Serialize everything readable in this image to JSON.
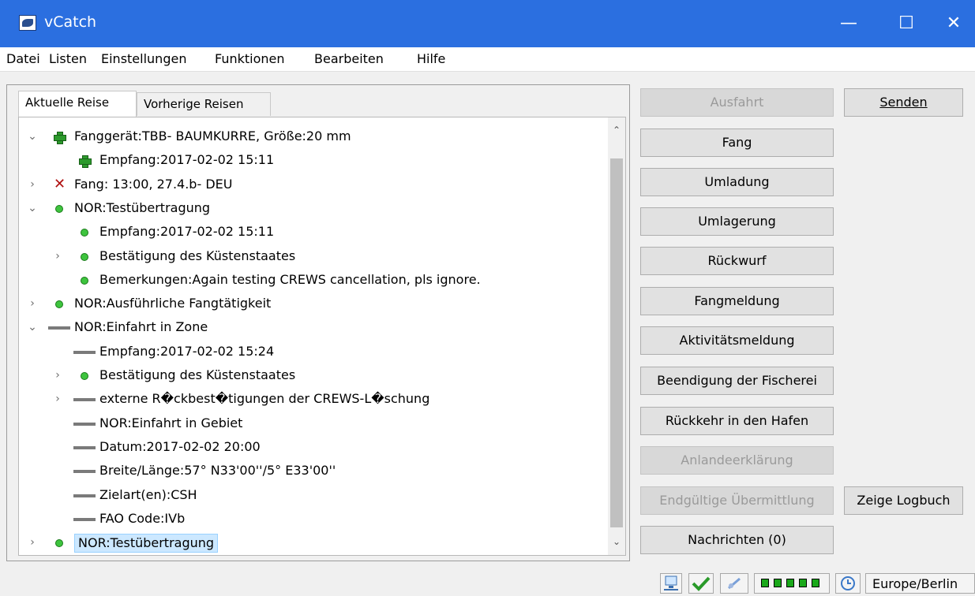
{
  "window": {
    "title": "vCatch",
    "minimize": "—",
    "maximize": "☐",
    "close": "✕"
  },
  "menu": [
    "Datei",
    "Listen",
    "Einstellungen",
    "Funktionen",
    "Bearbeiten",
    "Hilfe"
  ],
  "tabs": {
    "active": "Aktuelle Reise",
    "inactive": "Vorherige Reisen"
  },
  "tree": [
    {
      "label": "Fanggerät:TBB- BAUMKURRE, Größe:20 mm",
      "icon": "plus-icon",
      "expander": "⌄"
    },
    {
      "label": "Empfang:2017-02-02 15:11",
      "icon": "plus-icon",
      "expander": ""
    },
    {
      "label": "Fang: 13:00, 27.4.b- DEU",
      "icon": "cross-icon",
      "expander": "›"
    },
    {
      "label": "NOR:Testübertragung",
      "icon": "green-dot-icon",
      "expander": "⌄"
    },
    {
      "label": "Empfang:2017-02-02 15:11",
      "icon": "green-dot-icon",
      "expander": ""
    },
    {
      "label": "Bestätigung des Küstenstaates",
      "icon": "green-dot-icon",
      "expander": "›"
    },
    {
      "label": "Bemerkungen:Again testing CREWS cancellation, pls ignore.",
      "icon": "green-dot-icon",
      "expander": ""
    },
    {
      "label": "NOR:Ausführliche Fangtätigkeit",
      "icon": "green-dot-icon",
      "expander": "›"
    },
    {
      "label": "NOR:Einfahrt in Zone",
      "icon": "gray-bar-icon",
      "expander": "⌄"
    },
    {
      "label": "Empfang:2017-02-02 15:24",
      "icon": "gray-bar-icon",
      "expander": ""
    },
    {
      "label": "Bestätigung des Küstenstaates",
      "icon": "green-dot-icon",
      "expander": "›"
    },
    {
      "label": "externe R�ckbest�tigungen der CREWS-L�schung",
      "icon": "gray-bar-icon",
      "expander": "›"
    },
    {
      "label": "NOR:Einfahrt in Gebiet",
      "icon": "gray-bar-icon",
      "expander": ""
    },
    {
      "label": "Datum:2017-02-02 20:00",
      "icon": "gray-bar-icon",
      "expander": ""
    },
    {
      "label": "Breite/Länge:57° N33'00''/5° E33'00''",
      "icon": "gray-bar-icon",
      "expander": ""
    },
    {
      "label": "Zielart(en):CSH",
      "icon": "gray-bar-icon",
      "expander": ""
    },
    {
      "label": "FAO Code:IVb",
      "icon": "gray-bar-icon",
      "expander": ""
    },
    {
      "label": "NOR:Testübertragung",
      "icon": "green-dot-icon",
      "expander": "›",
      "selected": true
    }
  ],
  "scroll": {
    "up": "⌃",
    "down": "⌄"
  },
  "buttons": {
    "ausfahrt": "Ausfahrt",
    "fang": "Fang",
    "umladung": "Umladung",
    "umlagerung": "Umlagerung",
    "rueckwurf": "Rückwurf",
    "fangmeldung": "Fangmeldung",
    "aktivitaetsmeldung": "Aktivitätsmeldung",
    "beendigung": "Beendigung der Fischerei",
    "rueckkehr": "Rückkehr in den Hafen",
    "anlandeerklaerung": "Anlandeerklärung",
    "endgueltige": "Endgültige Übermittlung",
    "nachrichten": "Nachrichten (0)",
    "senden": "Senden",
    "logbuch": "Zeige Logbuch"
  },
  "status": {
    "timezone": "Europe/Berlin",
    "signal_bars_filled": 5,
    "signal_bars_total": 5,
    "colors": {
      "signal": "#1aa81a",
      "titlebar": "#2b6fe0"
    }
  }
}
